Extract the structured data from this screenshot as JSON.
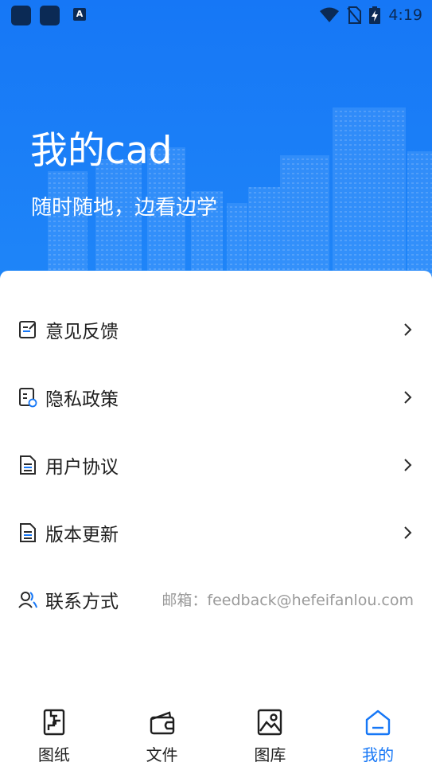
{
  "status_bar": {
    "time": "4:19",
    "icons": [
      "app-icon",
      "app-icon",
      "a-icon",
      "wifi-icon",
      "no-sim-icon",
      "battery-charging-icon"
    ]
  },
  "hero": {
    "title": "我的cad",
    "subtitle": "随时随地，边看边学"
  },
  "menu": {
    "items": [
      {
        "label": "意见反馈",
        "icon": "feedback-icon",
        "action": "chevron-right-icon"
      },
      {
        "label": "隐私政策",
        "icon": "privacy-icon",
        "action": "chevron-right-icon"
      },
      {
        "label": "用户协议",
        "icon": "document-icon",
        "action": "chevron-right-icon"
      },
      {
        "label": "版本更新",
        "icon": "document-icon",
        "action": "chevron-right-icon"
      },
      {
        "label": "联系方式",
        "icon": "contact-icon",
        "value": "邮箱：feedback@hefeifanlou.com"
      }
    ]
  },
  "tabbar": {
    "tabs": [
      {
        "label": "图纸",
        "icon": "drawing-icon"
      },
      {
        "label": "文件",
        "icon": "wallet-icon"
      },
      {
        "label": "图库",
        "icon": "gallery-icon"
      },
      {
        "label": "我的",
        "icon": "home-icon",
        "active": true
      }
    ]
  },
  "colors": {
    "primary": "#1677f6",
    "text": "#1f1f1f",
    "muted": "#9a9a9a",
    "background": "#ffffff"
  }
}
